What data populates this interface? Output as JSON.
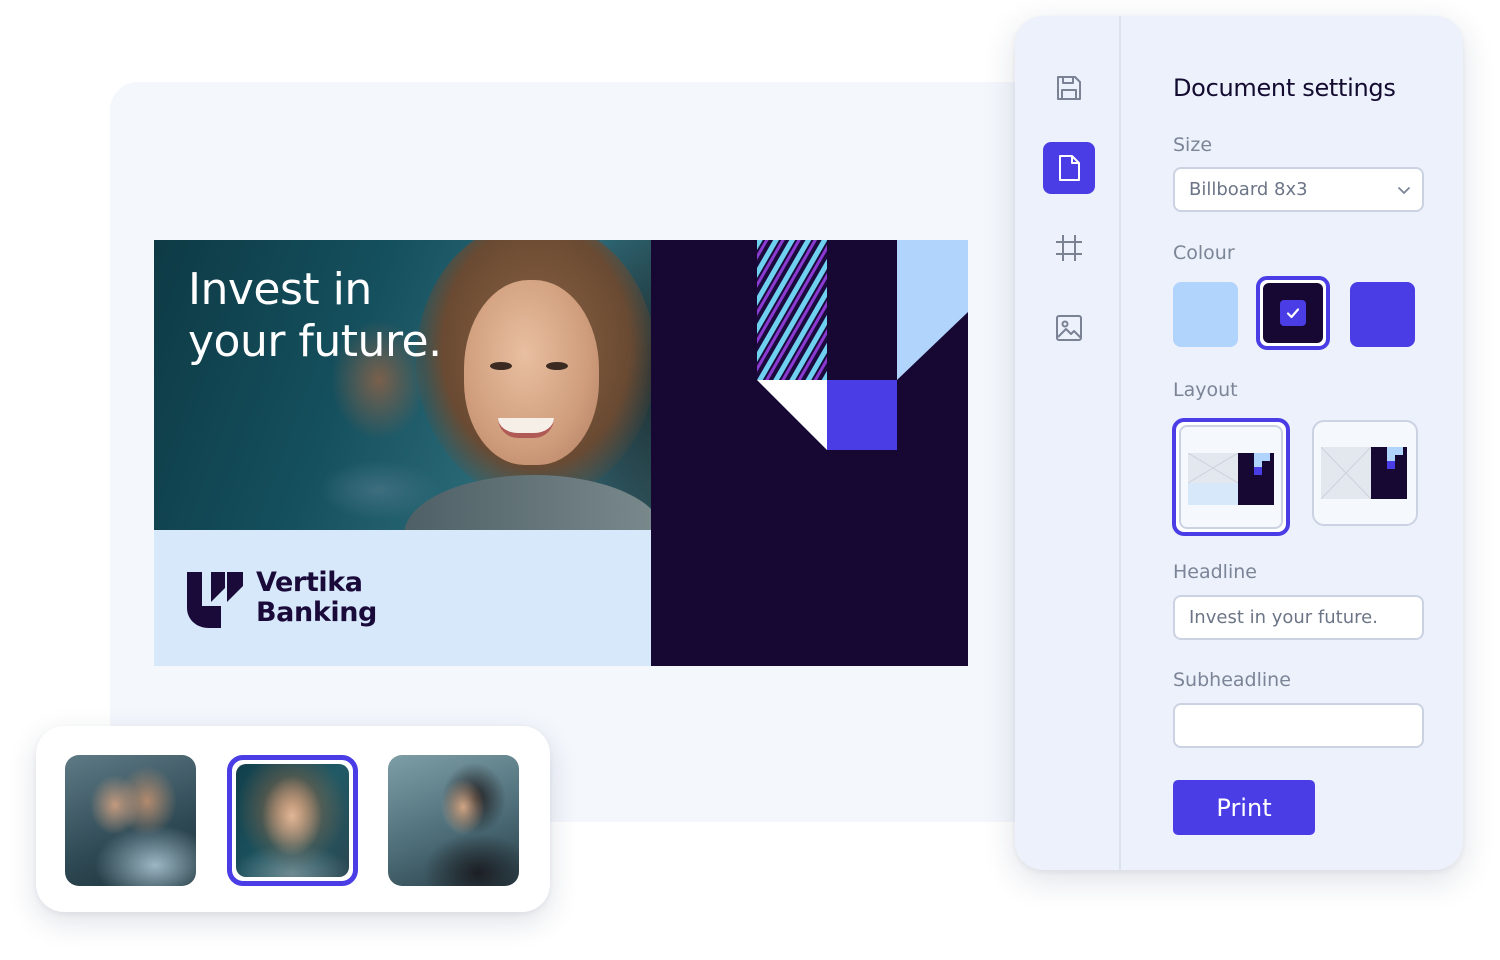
{
  "billboard": {
    "headline_line1": "Invest in",
    "headline_line2": "your future.",
    "brand_line1": "Vertika",
    "brand_line2": "Banking",
    "colors": {
      "dark": "#170733",
      "light_blue": "#d8e8fb",
      "accent_blue": "#b1d4fd",
      "violet": "#4a3de6"
    }
  },
  "images": {
    "thumbnails": [
      {
        "icon": "photo-colleagues",
        "selected": false
      },
      {
        "icon": "photo-smiling-woman",
        "selected": true
      },
      {
        "icon": "photo-woman-profile",
        "selected": false
      }
    ]
  },
  "sidebar": {
    "tools": [
      {
        "icon": "save-icon",
        "active": false
      },
      {
        "icon": "document-icon",
        "active": true
      },
      {
        "icon": "crop-icon",
        "active": false
      },
      {
        "icon": "image-icon",
        "active": false
      }
    ]
  },
  "settings": {
    "title": "Document settings",
    "size": {
      "label": "Size",
      "value": "Billboard 8x3"
    },
    "colour": {
      "label": "Colour",
      "options": [
        {
          "color": "#b1d4fd",
          "selected": false
        },
        {
          "color": "#170733",
          "selected": true
        },
        {
          "color": "#4a3de6",
          "selected": false
        }
      ]
    },
    "layout": {
      "label": "Layout",
      "options": [
        {
          "icon": "layout-with-brand-bar",
          "selected": true
        },
        {
          "icon": "layout-full-photo",
          "selected": false
        }
      ]
    },
    "headline": {
      "label": "Headline",
      "value": "Invest in your future."
    },
    "subheadline": {
      "label": "Subheadline",
      "value": ""
    },
    "print_label": "Print"
  }
}
